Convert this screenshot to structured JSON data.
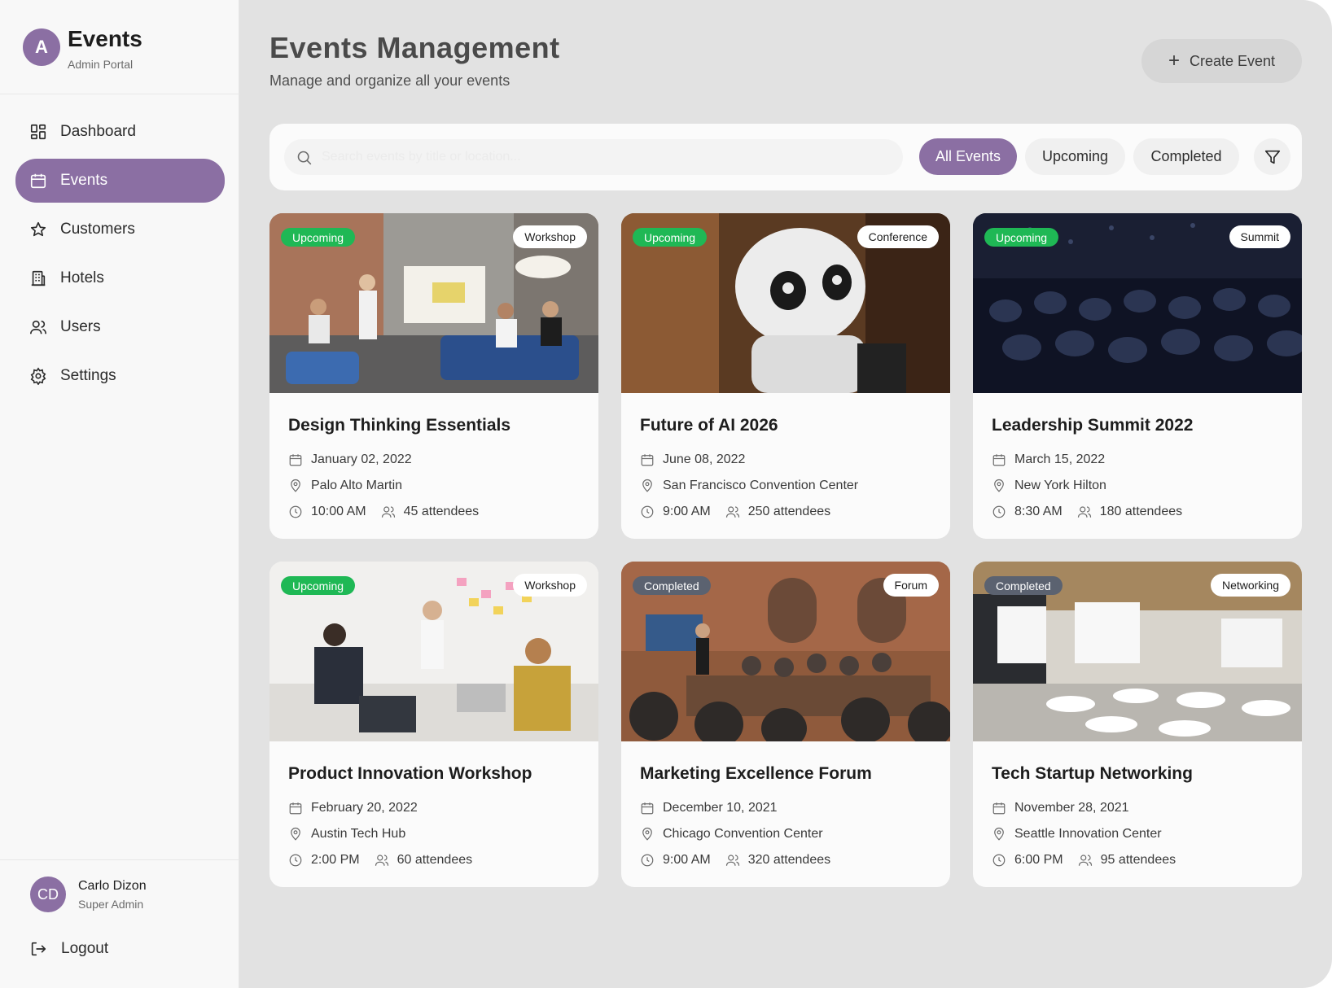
{
  "brand": {
    "initial": "A",
    "title": "Events",
    "subtitle": "Admin Portal"
  },
  "nav": [
    {
      "label": "Dashboard",
      "icon": "dashboard-icon"
    },
    {
      "label": "Events",
      "icon": "calendar-icon",
      "active": true
    },
    {
      "label": "Customers",
      "icon": "star-icon"
    },
    {
      "label": "Hotels",
      "icon": "building-icon"
    },
    {
      "label": "Users",
      "icon": "users-icon"
    },
    {
      "label": "Settings",
      "icon": "gear-icon"
    }
  ],
  "user": {
    "initials": "CD",
    "name": "Carlo Dizon",
    "role": "Super Admin",
    "logout_label": "Logout"
  },
  "header": {
    "title": "Events Management",
    "subtitle": "Manage and organize all your events",
    "create_label": "Create Event"
  },
  "toolbar": {
    "search_placeholder": "Search events by title or location...",
    "filters": [
      "All Events",
      "Upcoming",
      "Completed"
    ],
    "active_filter": "All Events"
  },
  "colors": {
    "accent": "#8b6fa3",
    "upcoming": "#1fb855",
    "completed": "#5b6270"
  },
  "events": [
    {
      "title": "Design Thinking Essentials",
      "status": "Upcoming",
      "type": "Workshop",
      "date": "January 02, 2022",
      "location": "Palo Alto Martin",
      "time": "10:00 AM",
      "attendees": "45 attendees"
    },
    {
      "title": "Future of AI 2026",
      "status": "Upcoming",
      "type": "Conference",
      "date": "June 08, 2022",
      "location": "San Francisco Convention Center",
      "time": "9:00 AM",
      "attendees": "250 attendees"
    },
    {
      "title": "Leadership Summit 2022",
      "status": "Upcoming",
      "type": "Summit",
      "date": "March 15, 2022",
      "location": "New York Hilton",
      "time": "8:30 AM",
      "attendees": "180 attendees"
    },
    {
      "title": "Product Innovation Workshop",
      "status": "Upcoming",
      "type": "Workshop",
      "date": "February 20, 2022",
      "location": "Austin Tech Hub",
      "time": "2:00 PM",
      "attendees": "60 attendees"
    },
    {
      "title": "Marketing Excellence Forum",
      "status": "Completed",
      "type": "Forum",
      "date": "December 10, 2021",
      "location": "Chicago Convention Center",
      "time": "9:00 AM",
      "attendees": "320 attendees"
    },
    {
      "title": "Tech Startup Networking",
      "status": "Completed",
      "type": "Networking",
      "date": "November 28, 2021",
      "location": "Seattle Innovation Center",
      "time": "6:00 PM",
      "attendees": "95 attendees"
    }
  ]
}
